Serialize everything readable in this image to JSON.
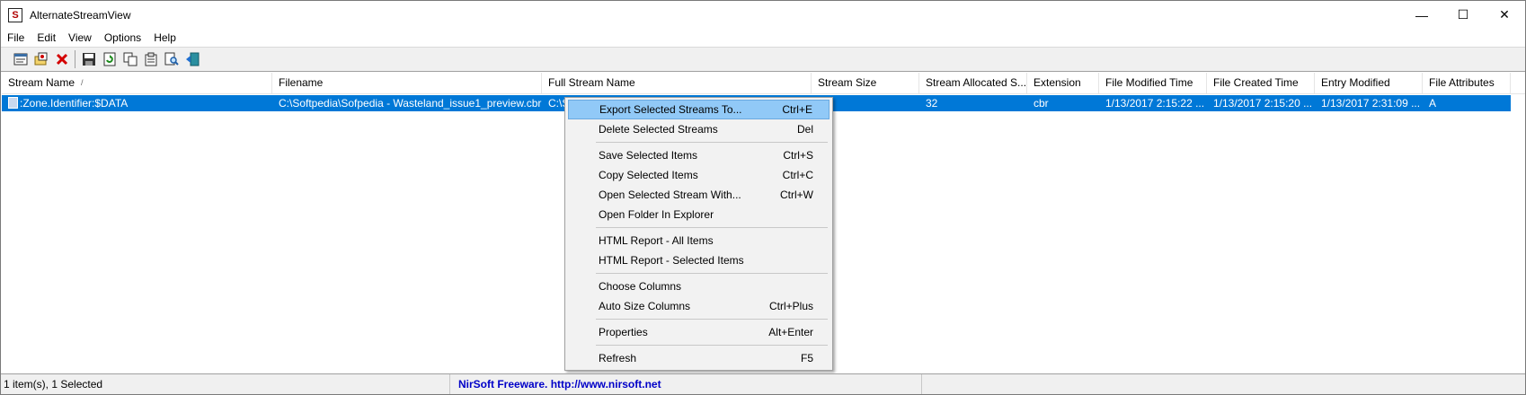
{
  "window": {
    "title": "AlternateStreamView",
    "controls": {
      "minimize": "—",
      "maximize": "☐",
      "close": "✕"
    }
  },
  "menu": [
    "File",
    "Edit",
    "View",
    "Options",
    "Help"
  ],
  "toolbar": {
    "buttons": [
      "select-folder-icon",
      "scan-icon",
      "delete-icon",
      "save-icon",
      "refresh-icon",
      "copy-icon",
      "properties-icon",
      "find-icon",
      "exit-icon"
    ]
  },
  "columns": [
    "Stream Name",
    "Filename",
    "Full Stream Name",
    "Stream Size",
    "Stream Allocated S...",
    "Extension",
    "File Modified Time",
    "File Created Time",
    "Entry Modified",
    "File Attributes"
  ],
  "sort_indicator": "/",
  "rows": [
    {
      "stream_name": ":Zone.Identifier:$DATA",
      "filename": "C:\\Softpedia\\Sofpedia - Wasteland_issue1_preview.cbr",
      "full_stream_name": "C:\\S",
      "stream_size": "",
      "stream_allocated": "32",
      "extension": "cbr",
      "file_modified": "1/13/2017 2:15:22 ...",
      "file_created": "1/13/2017 2:15:20 ...",
      "entry_modified": "1/13/2017 2:31:09 ...",
      "file_attributes": "A"
    }
  ],
  "context_menu": {
    "items": [
      {
        "label": "Export Selected Streams To...",
        "shortcut": "Ctrl+E",
        "hover": true
      },
      {
        "label": "Delete Selected Streams",
        "shortcut": "Del"
      },
      {
        "sep": true
      },
      {
        "label": "Save Selected Items",
        "shortcut": "Ctrl+S"
      },
      {
        "label": "Copy Selected Items",
        "shortcut": "Ctrl+C"
      },
      {
        "label": "Open Selected Stream With...",
        "shortcut": "Ctrl+W"
      },
      {
        "label": "Open Folder In Explorer",
        "shortcut": ""
      },
      {
        "sep": true
      },
      {
        "label": "HTML Report - All Items",
        "shortcut": ""
      },
      {
        "label": "HTML Report - Selected Items",
        "shortcut": ""
      },
      {
        "sep": true
      },
      {
        "label": "Choose Columns",
        "shortcut": ""
      },
      {
        "label": "Auto Size Columns",
        "shortcut": "Ctrl+Plus"
      },
      {
        "sep": true
      },
      {
        "label": "Properties",
        "shortcut": "Alt+Enter"
      },
      {
        "sep": true
      },
      {
        "label": "Refresh",
        "shortcut": "F5"
      }
    ]
  },
  "status": {
    "count": "1 item(s), 1 Selected",
    "link": "NirSoft Freeware.  http://www.nirsoft.net"
  },
  "colors": {
    "selection": "#0078d7",
    "menu_hover": "#91c9f7",
    "link": "#0000c8"
  }
}
